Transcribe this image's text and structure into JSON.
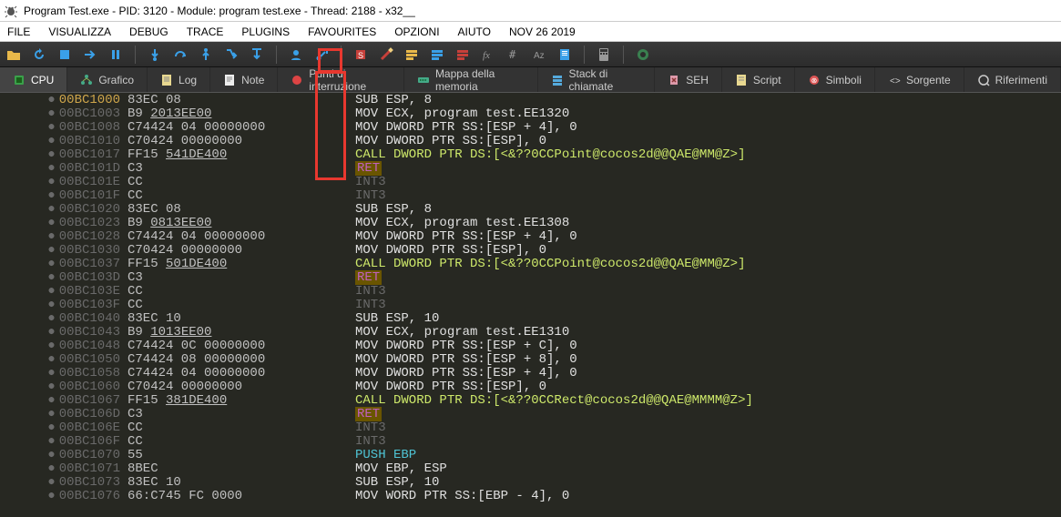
{
  "window": {
    "title": "Program Test.exe - PID: 3120 - Module: program test.exe - Thread: 2188 - x32__"
  },
  "menu": {
    "file": "FILE",
    "visualizza": "VISUALIZZA",
    "debug": "DEBUG",
    "trace": "TRACE",
    "plugins": "PLUGINS",
    "favourites": "FAVOURITES",
    "opzioni": "OPZIONI",
    "aiuto": "AIUTO",
    "date": "NOV 26 2019"
  },
  "tabs": {
    "cpu": "CPU",
    "grafico": "Grafico",
    "log": "Log",
    "note": "Note",
    "punti": "Punti di interruzione",
    "mappa": "Mappa della memoria",
    "stack": "Stack di chiamate",
    "seh": "SEH",
    "script": "Script",
    "simboli": "Simboli",
    "sorgente": "Sorgente",
    "riferimenti": "Riferimenti"
  },
  "disasm": {
    "rows": [
      {
        "addr": "00BC1000",
        "bytes": "83EC 08",
        "mnem": "SUB ESP, 8",
        "first": true
      },
      {
        "addr": "00BC1003",
        "bytes": "B9 2013EE00",
        "uline": "2013EE00",
        "mnem": "MOV ECX, program test.EE1320"
      },
      {
        "addr": "00BC1008",
        "bytes": "C74424 04 00000000",
        "mnem": "MOV DWORD PTR SS:[ESP + 4], 0"
      },
      {
        "addr": "00BC1010",
        "bytes": "C70424 00000000",
        "mnem": "MOV DWORD PTR SS:[ESP], 0"
      },
      {
        "addr": "00BC1017",
        "bytes": "FF15 541DE400",
        "uline": "541DE400",
        "mnem": "CALL DWORD PTR DS:[<&??0CCPoint@cocos2d@@QAE@MM@Z>]",
        "call": true
      },
      {
        "addr": "00BC101D",
        "bytes": "C3",
        "mnem": "RET",
        "ret": true
      },
      {
        "addr": "00BC101E",
        "bytes": "CC",
        "mnem": "INT3",
        "int3": true
      },
      {
        "addr": "00BC101F",
        "bytes": "CC",
        "mnem": "INT3",
        "int3": true
      },
      {
        "addr": "00BC1020",
        "bytes": "83EC 08",
        "mnem": "SUB ESP, 8"
      },
      {
        "addr": "00BC1023",
        "bytes": "B9 0813EE00",
        "uline": "0813EE00",
        "mnem": "MOV ECX, program test.EE1308"
      },
      {
        "addr": "00BC1028",
        "bytes": "C74424 04 00000000",
        "mnem": "MOV DWORD PTR SS:[ESP + 4], 0"
      },
      {
        "addr": "00BC1030",
        "bytes": "C70424 00000000",
        "mnem": "MOV DWORD PTR SS:[ESP], 0"
      },
      {
        "addr": "00BC1037",
        "bytes": "FF15 501DE400",
        "uline": "501DE400",
        "mnem": "CALL DWORD PTR DS:[<&??0CCPoint@cocos2d@@QAE@MM@Z>]",
        "call": true
      },
      {
        "addr": "00BC103D",
        "bytes": "C3",
        "mnem": "RET",
        "ret": true
      },
      {
        "addr": "00BC103E",
        "bytes": "CC",
        "mnem": "INT3",
        "int3": true
      },
      {
        "addr": "00BC103F",
        "bytes": "CC",
        "mnem": "INT3",
        "int3": true
      },
      {
        "addr": "00BC1040",
        "bytes": "83EC 10",
        "mnem": "SUB ESP, 10"
      },
      {
        "addr": "00BC1043",
        "bytes": "B9 1013EE00",
        "uline": "1013EE00",
        "mnem": "MOV ECX, program test.EE1310"
      },
      {
        "addr": "00BC1048",
        "bytes": "C74424 0C 00000000",
        "mnem": "MOV DWORD PTR SS:[ESP + C], 0"
      },
      {
        "addr": "00BC1050",
        "bytes": "C74424 08 00000000",
        "mnem": "MOV DWORD PTR SS:[ESP + 8], 0"
      },
      {
        "addr": "00BC1058",
        "bytes": "C74424 04 00000000",
        "mnem": "MOV DWORD PTR SS:[ESP + 4], 0"
      },
      {
        "addr": "00BC1060",
        "bytes": "C70424 00000000",
        "mnem": "MOV DWORD PTR SS:[ESP], 0"
      },
      {
        "addr": "00BC1067",
        "bytes": "FF15 381DE400",
        "uline": "381DE400",
        "mnem": "CALL DWORD PTR DS:[<&??0CCRect@cocos2d@@QAE@MMMM@Z>]",
        "call": true
      },
      {
        "addr": "00BC106D",
        "bytes": "C3",
        "mnem": "RET",
        "ret": true
      },
      {
        "addr": "00BC106E",
        "bytes": "CC",
        "mnem": "INT3",
        "int3": true
      },
      {
        "addr": "00BC106F",
        "bytes": "CC",
        "mnem": "INT3",
        "int3": true
      },
      {
        "addr": "00BC1070",
        "bytes": "55",
        "mnem": "PUSH EBP",
        "push": true
      },
      {
        "addr": "00BC1071",
        "bytes": "8BEC",
        "mnem": "MOV EBP, ESP"
      },
      {
        "addr": "00BC1073",
        "bytes": "83EC 10",
        "mnem": "SUB ESP, 10"
      },
      {
        "addr": "00BC1076",
        "bytes": "66:C745 FC 0000",
        "mnem": "MOV WORD PTR SS:[EBP - 4], 0"
      }
    ]
  },
  "arrow": {
    "visible": true
  }
}
